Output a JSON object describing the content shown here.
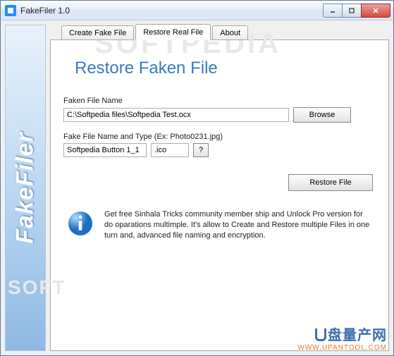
{
  "window": {
    "title": "FakeFiler 1.0"
  },
  "tabs": {
    "create": "Create Fake File",
    "restore": "Restore Real File",
    "about": "About"
  },
  "page": {
    "heading": "Restore Faken File",
    "faken_label": "Faken File Name",
    "faken_path": "C:\\Softpedia files\\Softpedia Test.ocx",
    "browse": "Browse",
    "fake_label": "Fake File Name and Type (Ex: Photo0231.jpg)",
    "fake_name": "Softpedia Button 1_1",
    "fake_ext": ".ico",
    "help": "?",
    "restore_btn": "Restore File",
    "info_text": "Get free Sinhala Tricks community member ship and Unlock Pro version for do oparations multimple. It's allow to Create and Restore multiple Files in one turn and, advanced file naming and encryption."
  },
  "sidebar": {
    "brand": "FakeFiler"
  },
  "watermark": {
    "cn": "盘量产网",
    "url": "WWW.UPANTOOL.COM"
  },
  "bg": {
    "text": "SOFTPEDIA"
  }
}
